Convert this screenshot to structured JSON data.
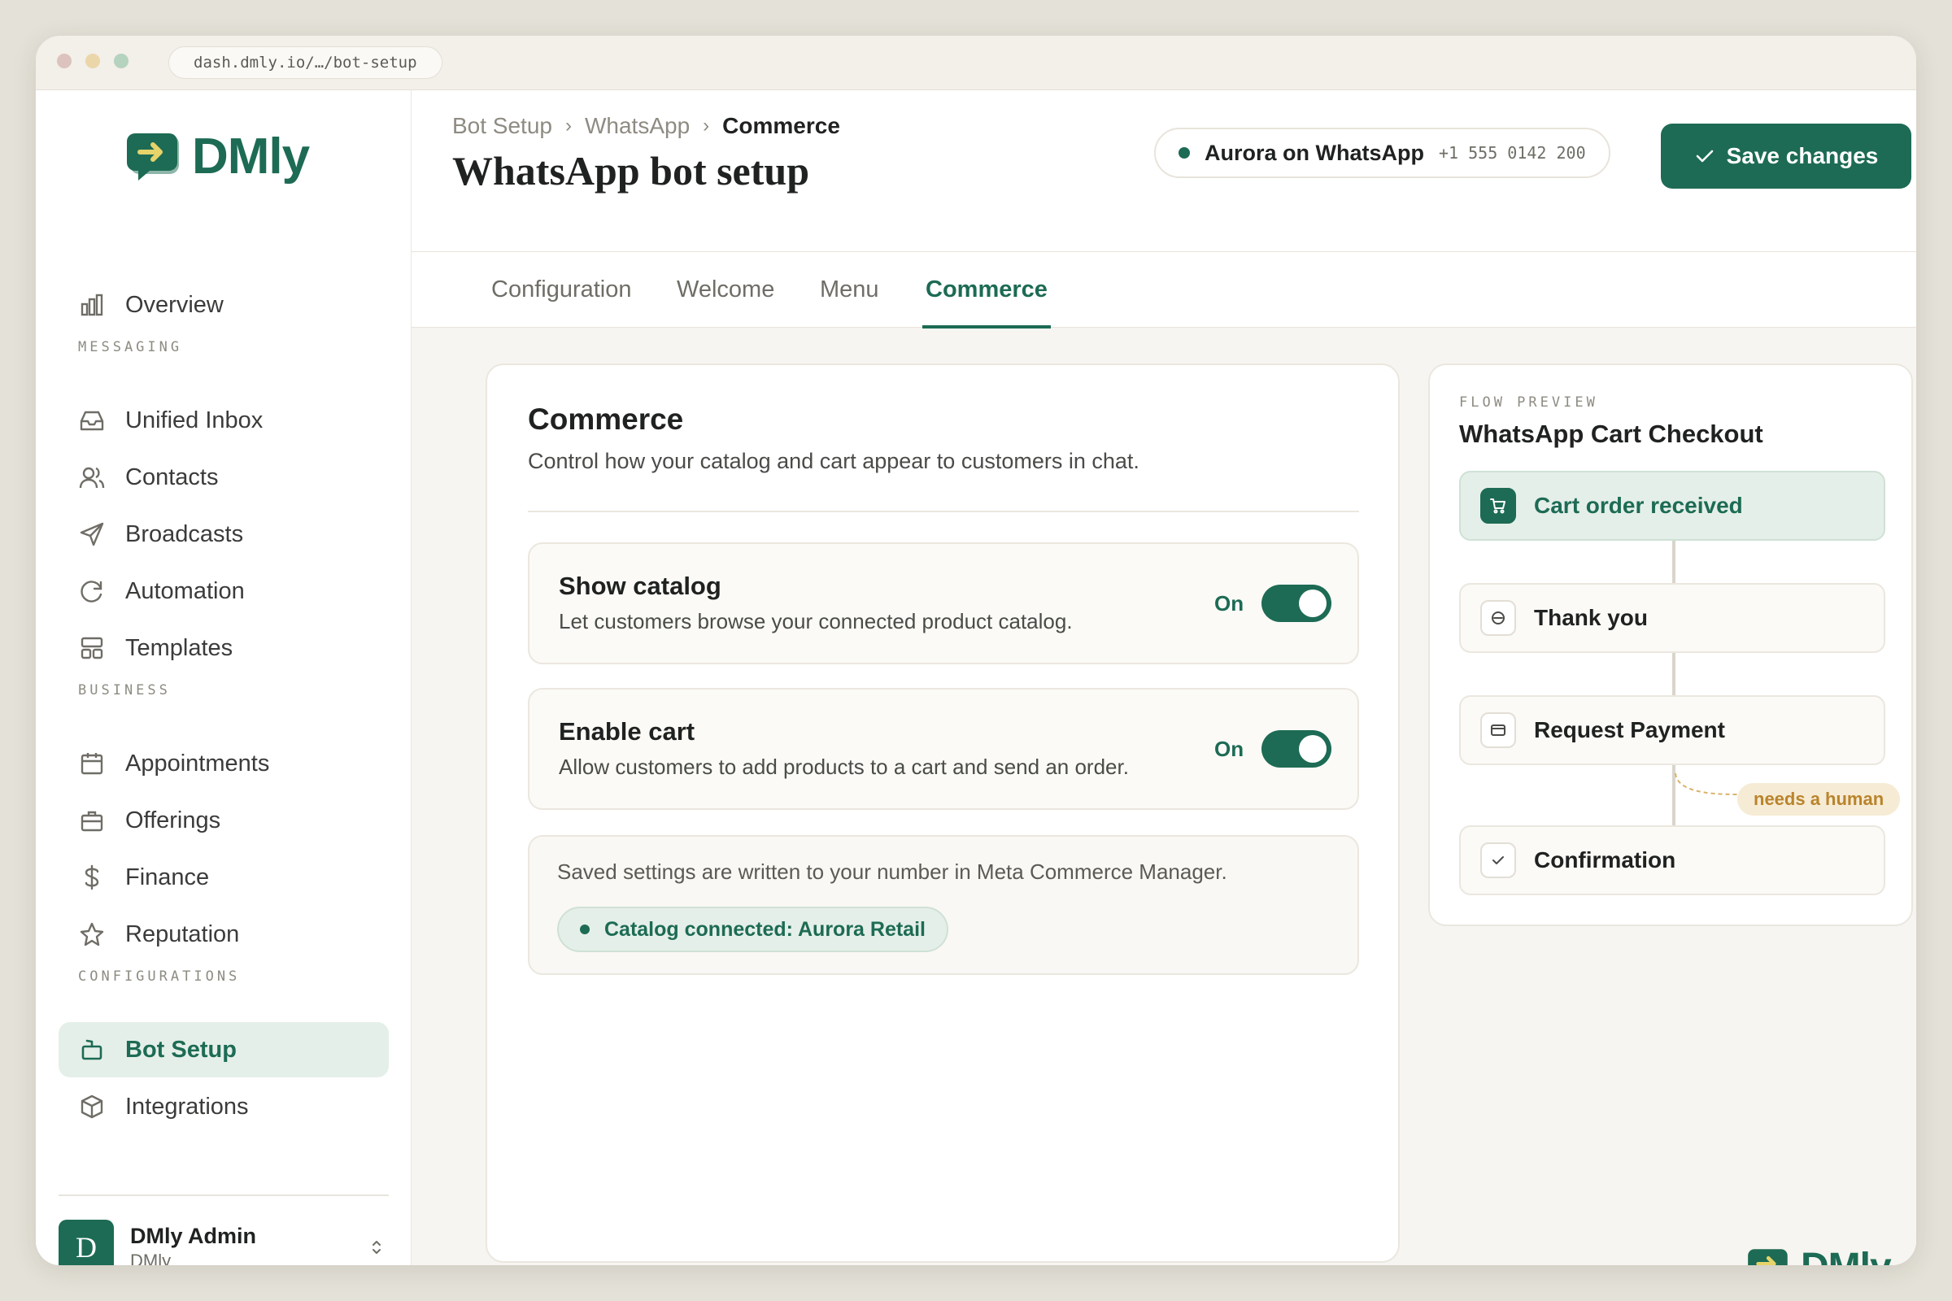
{
  "browser": {
    "url": "dash.dmly.io/…/bot-setup"
  },
  "brand": {
    "name": "DMly",
    "accent": "#1d6b54"
  },
  "sidebar": {
    "overview": {
      "label": "Overview",
      "icon": "bar-chart-icon"
    },
    "sections": [
      {
        "label": "MESSAGING",
        "items": [
          {
            "label": "Unified Inbox",
            "icon": "inbox-icon"
          },
          {
            "label": "Contacts",
            "icon": "users-icon"
          },
          {
            "label": "Broadcasts",
            "icon": "send-icon"
          },
          {
            "label": "Automation",
            "icon": "refresh-icon"
          },
          {
            "label": "Templates",
            "icon": "layout-icon"
          }
        ]
      },
      {
        "label": "BUSINESS",
        "items": [
          {
            "label": "Appointments",
            "icon": "calendar-icon"
          },
          {
            "label": "Offerings",
            "icon": "briefcase-icon"
          },
          {
            "label": "Finance",
            "icon": "dollar-icon"
          },
          {
            "label": "Reputation",
            "icon": "star-icon"
          }
        ]
      },
      {
        "label": "CONFIGURATIONS",
        "items": [
          {
            "label": "Bot Setup",
            "icon": "bot-icon",
            "active": true
          },
          {
            "label": "Integrations",
            "icon": "box-icon"
          }
        ]
      }
    ],
    "user": {
      "initial": "D",
      "name": "DMly Admin",
      "org": "DMly"
    }
  },
  "header": {
    "breadcrumbs": [
      "Bot Setup",
      "WhatsApp",
      "Commerce"
    ],
    "title": "WhatsApp bot setup",
    "status": {
      "name": "Aurora on WhatsApp",
      "phone": "+1 555 0142 200"
    },
    "save_label": "Save changes"
  },
  "tabs": [
    {
      "label": "Configuration"
    },
    {
      "label": "Welcome"
    },
    {
      "label": "Menu"
    },
    {
      "label": "Commerce",
      "active": true
    }
  ],
  "commerce": {
    "title": "Commerce",
    "subtitle": "Control how your catalog and cart appear to customers in chat.",
    "settings": [
      {
        "title": "Show catalog",
        "description": "Let customers browse your connected product catalog.",
        "state": "On",
        "enabled": true
      },
      {
        "title": "Enable cart",
        "description": "Allow customers to add products to a cart and send an order.",
        "state": "On",
        "enabled": true
      }
    ],
    "note": "Saved settings are written to your number in Meta Commerce Manager.",
    "catalog_status": "Catalog connected: Aurora Retail"
  },
  "flow_preview": {
    "label": "FLOW PREVIEW",
    "title": "WhatsApp Cart Checkout",
    "steps": [
      {
        "label": "Cart order received",
        "icon": "cart-icon"
      },
      {
        "label": "Thank you",
        "icon": "emoji-icon"
      },
      {
        "label": "Request Payment",
        "icon": "card-icon"
      },
      {
        "label": "Confirmation",
        "icon": "check-icon"
      }
    ],
    "badge": "needs a human"
  }
}
